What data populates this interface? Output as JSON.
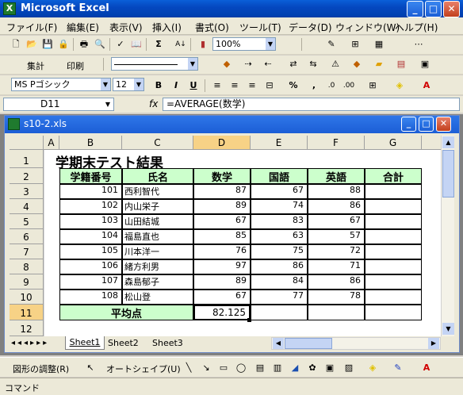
{
  "app": {
    "title": "Microsoft Excel",
    "logo": "X",
    "min": "_",
    "max": "□",
    "close": "✕"
  },
  "menu": [
    "ファイル(F)",
    "編集(E)",
    "表示(V)",
    "挿入(I)",
    "書式(O)",
    "ツール(T)",
    "データ(D)",
    "ウィンドウ(W)",
    "ヘルプ(H)"
  ],
  "toolbar1": {
    "zoom": "100%"
  },
  "toolbar2": {
    "shukei": "集計",
    "insatsu": "印刷"
  },
  "format": {
    "font": "MS Pゴシック",
    "size": "12",
    "bold": "B",
    "italic": "I",
    "underline": "U"
  },
  "formula": {
    "namebox": "D11",
    "fx": "fx",
    "content": "=AVERAGE(数学)"
  },
  "doc": {
    "title": "s10-2.xls",
    "min": "_",
    "max": "□",
    "close": "✕"
  },
  "columns": [
    "A",
    "B",
    "C",
    "D",
    "E",
    "F",
    "G"
  ],
  "rows": [
    "1",
    "2",
    "3",
    "4",
    "5",
    "6",
    "7",
    "8",
    "9",
    "10",
    "11",
    "12"
  ],
  "sheet": {
    "title": "学期末テスト結果",
    "headers": [
      "学籍番号",
      "氏名",
      "数学",
      "国語",
      "英語",
      "合計"
    ],
    "records": [
      {
        "id": "101",
        "name": "西利智代",
        "math": "87",
        "jpn": "67",
        "eng": "88"
      },
      {
        "id": "102",
        "name": "内山栄子",
        "math": "89",
        "jpn": "74",
        "eng": "86"
      },
      {
        "id": "103",
        "name": "山田結城",
        "math": "67",
        "jpn": "83",
        "eng": "67"
      },
      {
        "id": "104",
        "name": "福島直也",
        "math": "85",
        "jpn": "63",
        "eng": "57"
      },
      {
        "id": "105",
        "name": "川本洋一",
        "math": "76",
        "jpn": "75",
        "eng": "72"
      },
      {
        "id": "106",
        "name": "緒方利男",
        "math": "97",
        "jpn": "86",
        "eng": "71"
      },
      {
        "id": "107",
        "name": "森島郁子",
        "math": "89",
        "jpn": "84",
        "eng": "86"
      },
      {
        "id": "108",
        "name": "松山登",
        "math": "67",
        "jpn": "77",
        "eng": "78"
      }
    ],
    "avg_label": "平均点",
    "avg_value": "82.125"
  },
  "tabs": [
    "Sheet1",
    "Sheet2",
    "Sheet3"
  ],
  "drawing": {
    "adjust": "図形の調整(R)",
    "autoshape": "オートシェイプ(U)"
  },
  "status": "コマンド"
}
